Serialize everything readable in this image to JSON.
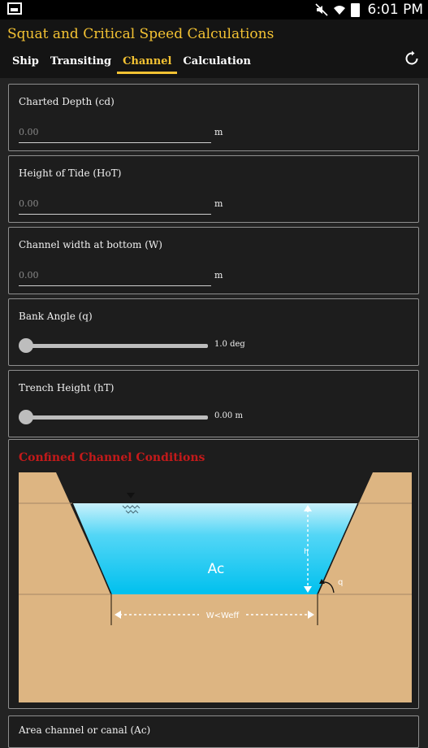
{
  "status_bar": {
    "time": "6:01 PM"
  },
  "app": {
    "title": "Squat and Critical Speed Calculations"
  },
  "tabs": [
    {
      "label": "Ship",
      "active": false
    },
    {
      "label": "Transiting",
      "active": false
    },
    {
      "label": "Channel",
      "active": true
    },
    {
      "label": "Calculation",
      "active": false
    }
  ],
  "fields": [
    {
      "label": "Charted Depth (cd)",
      "placeholder": "0.00",
      "unit": "m"
    },
    {
      "label": "Height of Tide (HoT)",
      "placeholder": "0.00",
      "unit": "m"
    },
    {
      "label": "Channel width at bottom (W)",
      "placeholder": "0.00",
      "unit": "m"
    }
  ],
  "sliders": [
    {
      "label": "Bank Angle (q)",
      "value": "1.0 deg",
      "level": 0
    },
    {
      "label": "Trench Height (hT)",
      "value": "0.00 m",
      "level": 0
    }
  ],
  "diagram": {
    "title": "Confined Channel Conditions",
    "area_label": "Ac",
    "depth_label": "h",
    "angle_label": "q",
    "width_label": "W<Weff"
  },
  "bottom_card": {
    "label": "Area channel or canal (Ac)"
  },
  "colors": {
    "accent": "#f3c233",
    "diagram_title": "#c41a1a",
    "sand": "#ddb582",
    "water_top": "#c9f1fb",
    "water_bottom": "#00c0ee"
  }
}
